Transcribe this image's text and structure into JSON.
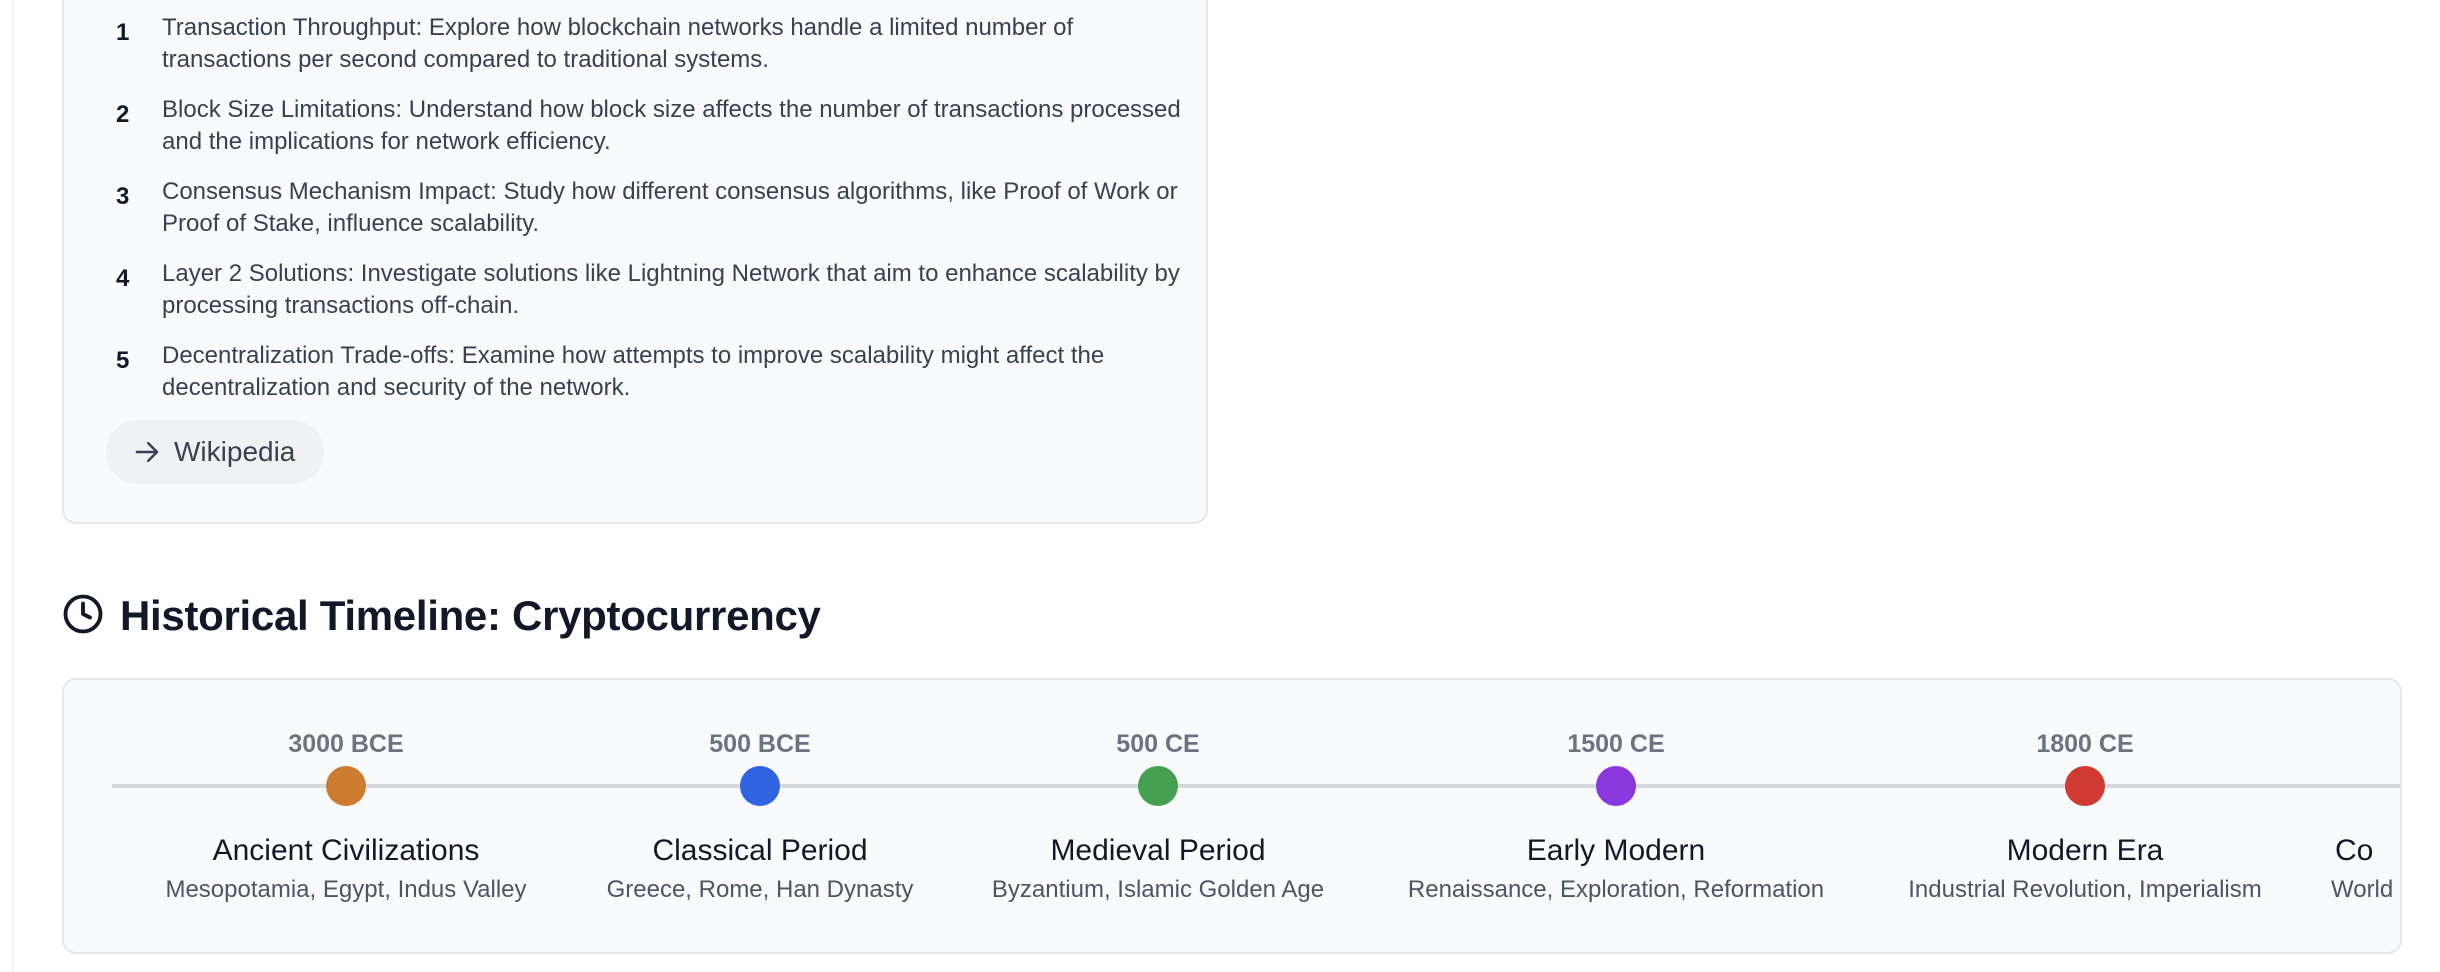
{
  "scalability": {
    "items": [
      {
        "number": "1",
        "text": "Transaction Throughput: Explore how blockchain networks handle a limited number of transactions per second compared to traditional systems."
      },
      {
        "number": "2",
        "text": "Block Size Limitations: Understand how block size affects the number of transactions processed and the implications for network efficiency."
      },
      {
        "number": "3",
        "text": "Consensus Mechanism Impact: Study how different consensus algorithms, like Proof of Work or Proof of Stake, influence scalability."
      },
      {
        "number": "4",
        "text": "Layer 2 Solutions: Investigate solutions like Lightning Network that aim to enhance scalability by processing transactions off-chain."
      },
      {
        "number": "5",
        "text": "Decentralization Trade-offs: Examine how attempts to improve scalability might affect the decentralization and security of the network."
      }
    ],
    "wiki_label": "Wikipedia",
    "wiki_icon": "arrow-right-icon"
  },
  "timeline": {
    "title": "Historical Timeline: Cryptocurrency",
    "icon": "clock-icon",
    "eras": [
      {
        "date": "3000 BCE",
        "name": "Ancient Civilizations",
        "desc": "Mesopotamia, Egypt, Indus Valley",
        "color": "#cd7b2e"
      },
      {
        "date": "500 BCE",
        "name": "Classical Period",
        "desc": "Greece, Rome, Han Dynasty",
        "color": "#2f63e0"
      },
      {
        "date": "500 CE",
        "name": "Medieval Period",
        "desc": "Byzantium, Islamic Golden Age",
        "color": "#44a04f"
      },
      {
        "date": "1500 CE",
        "name": "Early Modern",
        "desc": "Renaissance, Exploration, Reformation",
        "color": "#8a38dd"
      },
      {
        "date": "1800 CE",
        "name": "Modern Era",
        "desc": "Industrial Revolution, Imperialism",
        "color": "#d03a32"
      },
      {
        "date": "",
        "name": "Co",
        "desc": "World W",
        "color": ""
      }
    ]
  }
}
